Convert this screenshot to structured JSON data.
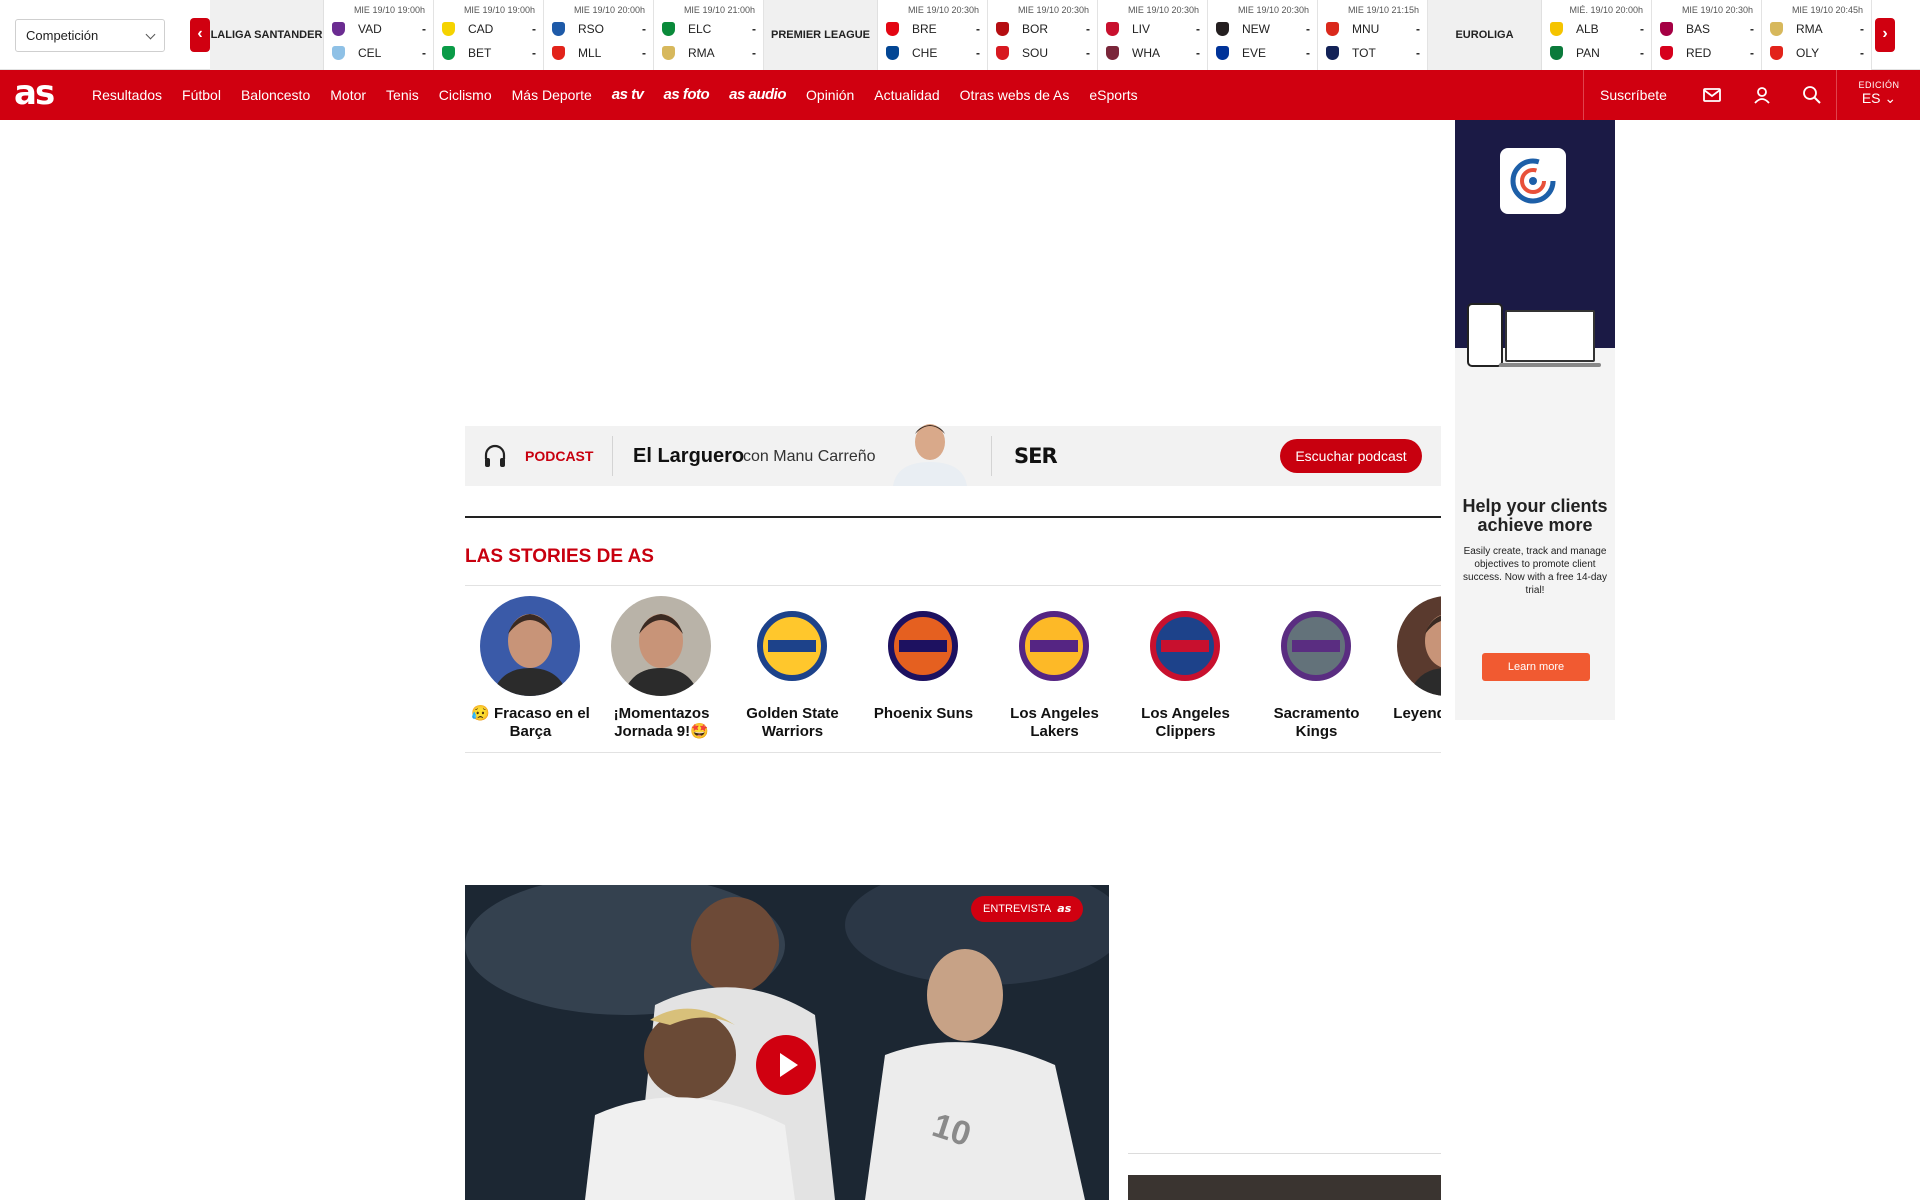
{
  "ticker": {
    "competition_select": "Competición",
    "prev_arrow": "‹",
    "next_arrow": "›",
    "leagues": [
      {
        "name": "LALIGA SANTANDER",
        "matches": [
          {
            "time": "MIE 19/10 19:00h",
            "home": "VAD",
            "away": "CEL",
            "home_score": "-",
            "away_score": "-",
            "home_color": "#6b2c91",
            "away_color": "#8fc1e6"
          },
          {
            "time": "MIE 19/10 19:00h",
            "home": "CAD",
            "away": "BET",
            "home_score": "-",
            "away_score": "-",
            "home_color": "#f5d300",
            "away_color": "#0a9b47"
          },
          {
            "time": "MIE 19/10 20:00h",
            "home": "RSO",
            "away": "MLL",
            "home_score": "-",
            "away_score": "-",
            "home_color": "#1e5aa8",
            "away_color": "#e2231a"
          },
          {
            "time": "MIE 19/10 21:00h",
            "home": "ELC",
            "away": "RMA",
            "home_score": "-",
            "away_score": "-",
            "home_color": "#0a8a3a",
            "away_color": "#d7b85c"
          }
        ]
      },
      {
        "name": "PREMIER LEAGUE",
        "matches": [
          {
            "time": "MIE 19/10 20:30h",
            "home": "BRE",
            "away": "CHE",
            "home_score": "-",
            "away_score": "-",
            "home_color": "#e30613",
            "away_color": "#034694"
          },
          {
            "time": "MIE 19/10 20:30h",
            "home": "BOR",
            "away": "SOU",
            "home_score": "-",
            "away_score": "-",
            "home_color": "#b50e12",
            "away_color": "#d71920"
          },
          {
            "time": "MIE 19/10 20:30h",
            "home": "LIV",
            "away": "WHA",
            "home_score": "-",
            "away_score": "-",
            "home_color": "#c8102e",
            "away_color": "#7a263a"
          },
          {
            "time": "MIE 19/10 20:30h",
            "home": "NEW",
            "away": "EVE",
            "home_score": "-",
            "away_score": "-",
            "home_color": "#241f20",
            "away_color": "#003399"
          },
          {
            "time": "MIE 19/10 21:15h",
            "home": "MNU",
            "away": "TOT",
            "home_score": "-",
            "away_score": "-",
            "home_color": "#da291c",
            "away_color": "#132257"
          }
        ]
      },
      {
        "name": "EUROLIGA",
        "matches": [
          {
            "time": "MIÉ. 19/10 20:00h",
            "home": "ALB",
            "away": "PAN",
            "home_score": "-",
            "away_score": "-",
            "home_color": "#f5c400",
            "away_color": "#0b7a3b"
          },
          {
            "time": "MIE 19/10 20:30h",
            "home": "BAS",
            "away": "RED",
            "home_score": "-",
            "away_score": "-",
            "home_color": "#a50044",
            "away_color": "#d6001c"
          },
          {
            "time": "MIE 19/10 20:45h",
            "home": "RMA",
            "away": "OLY",
            "home_score": "-",
            "away_score": "-",
            "home_color": "#d7b85c",
            "away_color": "#e2231a"
          }
        ]
      }
    ]
  },
  "nav": {
    "logo": "as",
    "items": [
      "Resultados",
      "Fútbol",
      "Baloncesto",
      "Motor",
      "Tenis",
      "Ciclismo",
      "Más Deporte"
    ],
    "brands": [
      "as tv",
      "as foto",
      "as audio"
    ],
    "items_after": [
      "Opinión",
      "Actualidad",
      "Otras webs de As",
      "eSports"
    ],
    "subscribe": "Suscríbete",
    "edition_label": "EDICIÓN",
    "edition_value": "ES"
  },
  "side_ad": {
    "headline": "Help your clients achieve more",
    "body": "Easily create, track and manage objectives to promote client success. Now with a free 14-day trial!",
    "cta": "Learn more",
    "background": "#1b1a45",
    "cta_color": "#f15a31"
  },
  "podcast": {
    "kicker": "PODCAST",
    "show": "El Larguero",
    "host": "con Manu Carreño",
    "network": "SER",
    "cta": "Escuchar podcast"
  },
  "stories": {
    "title": "LAS STORIES DE AS",
    "items": [
      {
        "label": "😥 Fracaso en el Barça",
        "icon": "person-photo",
        "bg": "#3a5aa8"
      },
      {
        "label": "¡Momentazos Jornada 9!🤩",
        "icon": "person-photo",
        "bg": "#b9b3a8"
      },
      {
        "label": "Golden State Warriors",
        "icon": "warriors-logo",
        "bg": "#ffffff"
      },
      {
        "label": "Phoenix Suns",
        "icon": "suns-logo",
        "bg": "#ffffff"
      },
      {
        "label": "Los Angeles Lakers",
        "icon": "lakers-logo",
        "bg": "#ffffff"
      },
      {
        "label": "Los Angeles Clippers",
        "icon": "clippers-logo",
        "bg": "#ffffff"
      },
      {
        "label": "Sacramento Kings",
        "icon": "kings-logo",
        "bg": "#ffffff"
      },
      {
        "label": "Leyendas mate",
        "icon": "person-photo",
        "bg": "#5a3a2e"
      }
    ]
  },
  "hero": {
    "badge": "ENTREVISTA",
    "badge_brand": "as"
  },
  "colors": {
    "brand_red": "#d00010",
    "kicker_red": "#c8000f"
  }
}
